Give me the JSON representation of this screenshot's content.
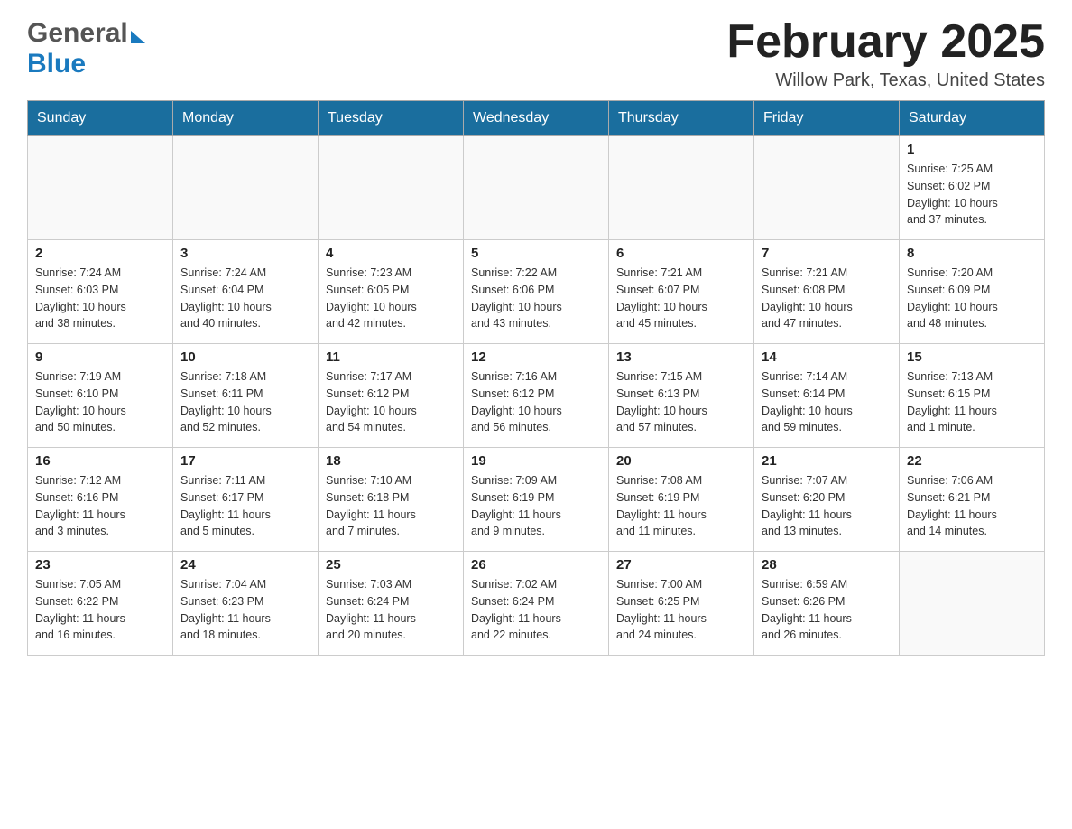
{
  "header": {
    "logo_line1": "General",
    "logo_line2": "Blue",
    "month_title": "February 2025",
    "location": "Willow Park, Texas, United States"
  },
  "weekdays": [
    "Sunday",
    "Monday",
    "Tuesday",
    "Wednesday",
    "Thursday",
    "Friday",
    "Saturday"
  ],
  "weeks": [
    [
      {
        "day": "",
        "info": ""
      },
      {
        "day": "",
        "info": ""
      },
      {
        "day": "",
        "info": ""
      },
      {
        "day": "",
        "info": ""
      },
      {
        "day": "",
        "info": ""
      },
      {
        "day": "",
        "info": ""
      },
      {
        "day": "1",
        "info": "Sunrise: 7:25 AM\nSunset: 6:02 PM\nDaylight: 10 hours\nand 37 minutes."
      }
    ],
    [
      {
        "day": "2",
        "info": "Sunrise: 7:24 AM\nSunset: 6:03 PM\nDaylight: 10 hours\nand 38 minutes."
      },
      {
        "day": "3",
        "info": "Sunrise: 7:24 AM\nSunset: 6:04 PM\nDaylight: 10 hours\nand 40 minutes."
      },
      {
        "day": "4",
        "info": "Sunrise: 7:23 AM\nSunset: 6:05 PM\nDaylight: 10 hours\nand 42 minutes."
      },
      {
        "day": "5",
        "info": "Sunrise: 7:22 AM\nSunset: 6:06 PM\nDaylight: 10 hours\nand 43 minutes."
      },
      {
        "day": "6",
        "info": "Sunrise: 7:21 AM\nSunset: 6:07 PM\nDaylight: 10 hours\nand 45 minutes."
      },
      {
        "day": "7",
        "info": "Sunrise: 7:21 AM\nSunset: 6:08 PM\nDaylight: 10 hours\nand 47 minutes."
      },
      {
        "day": "8",
        "info": "Sunrise: 7:20 AM\nSunset: 6:09 PM\nDaylight: 10 hours\nand 48 minutes."
      }
    ],
    [
      {
        "day": "9",
        "info": "Sunrise: 7:19 AM\nSunset: 6:10 PM\nDaylight: 10 hours\nand 50 minutes."
      },
      {
        "day": "10",
        "info": "Sunrise: 7:18 AM\nSunset: 6:11 PM\nDaylight: 10 hours\nand 52 minutes."
      },
      {
        "day": "11",
        "info": "Sunrise: 7:17 AM\nSunset: 6:12 PM\nDaylight: 10 hours\nand 54 minutes."
      },
      {
        "day": "12",
        "info": "Sunrise: 7:16 AM\nSunset: 6:12 PM\nDaylight: 10 hours\nand 56 minutes."
      },
      {
        "day": "13",
        "info": "Sunrise: 7:15 AM\nSunset: 6:13 PM\nDaylight: 10 hours\nand 57 minutes."
      },
      {
        "day": "14",
        "info": "Sunrise: 7:14 AM\nSunset: 6:14 PM\nDaylight: 10 hours\nand 59 minutes."
      },
      {
        "day": "15",
        "info": "Sunrise: 7:13 AM\nSunset: 6:15 PM\nDaylight: 11 hours\nand 1 minute."
      }
    ],
    [
      {
        "day": "16",
        "info": "Sunrise: 7:12 AM\nSunset: 6:16 PM\nDaylight: 11 hours\nand 3 minutes."
      },
      {
        "day": "17",
        "info": "Sunrise: 7:11 AM\nSunset: 6:17 PM\nDaylight: 11 hours\nand 5 minutes."
      },
      {
        "day": "18",
        "info": "Sunrise: 7:10 AM\nSunset: 6:18 PM\nDaylight: 11 hours\nand 7 minutes."
      },
      {
        "day": "19",
        "info": "Sunrise: 7:09 AM\nSunset: 6:19 PM\nDaylight: 11 hours\nand 9 minutes."
      },
      {
        "day": "20",
        "info": "Sunrise: 7:08 AM\nSunset: 6:19 PM\nDaylight: 11 hours\nand 11 minutes."
      },
      {
        "day": "21",
        "info": "Sunrise: 7:07 AM\nSunset: 6:20 PM\nDaylight: 11 hours\nand 13 minutes."
      },
      {
        "day": "22",
        "info": "Sunrise: 7:06 AM\nSunset: 6:21 PM\nDaylight: 11 hours\nand 14 minutes."
      }
    ],
    [
      {
        "day": "23",
        "info": "Sunrise: 7:05 AM\nSunset: 6:22 PM\nDaylight: 11 hours\nand 16 minutes."
      },
      {
        "day": "24",
        "info": "Sunrise: 7:04 AM\nSunset: 6:23 PM\nDaylight: 11 hours\nand 18 minutes."
      },
      {
        "day": "25",
        "info": "Sunrise: 7:03 AM\nSunset: 6:24 PM\nDaylight: 11 hours\nand 20 minutes."
      },
      {
        "day": "26",
        "info": "Sunrise: 7:02 AM\nSunset: 6:24 PM\nDaylight: 11 hours\nand 22 minutes."
      },
      {
        "day": "27",
        "info": "Sunrise: 7:00 AM\nSunset: 6:25 PM\nDaylight: 11 hours\nand 24 minutes."
      },
      {
        "day": "28",
        "info": "Sunrise: 6:59 AM\nSunset: 6:26 PM\nDaylight: 11 hours\nand 26 minutes."
      },
      {
        "day": "",
        "info": ""
      }
    ]
  ]
}
